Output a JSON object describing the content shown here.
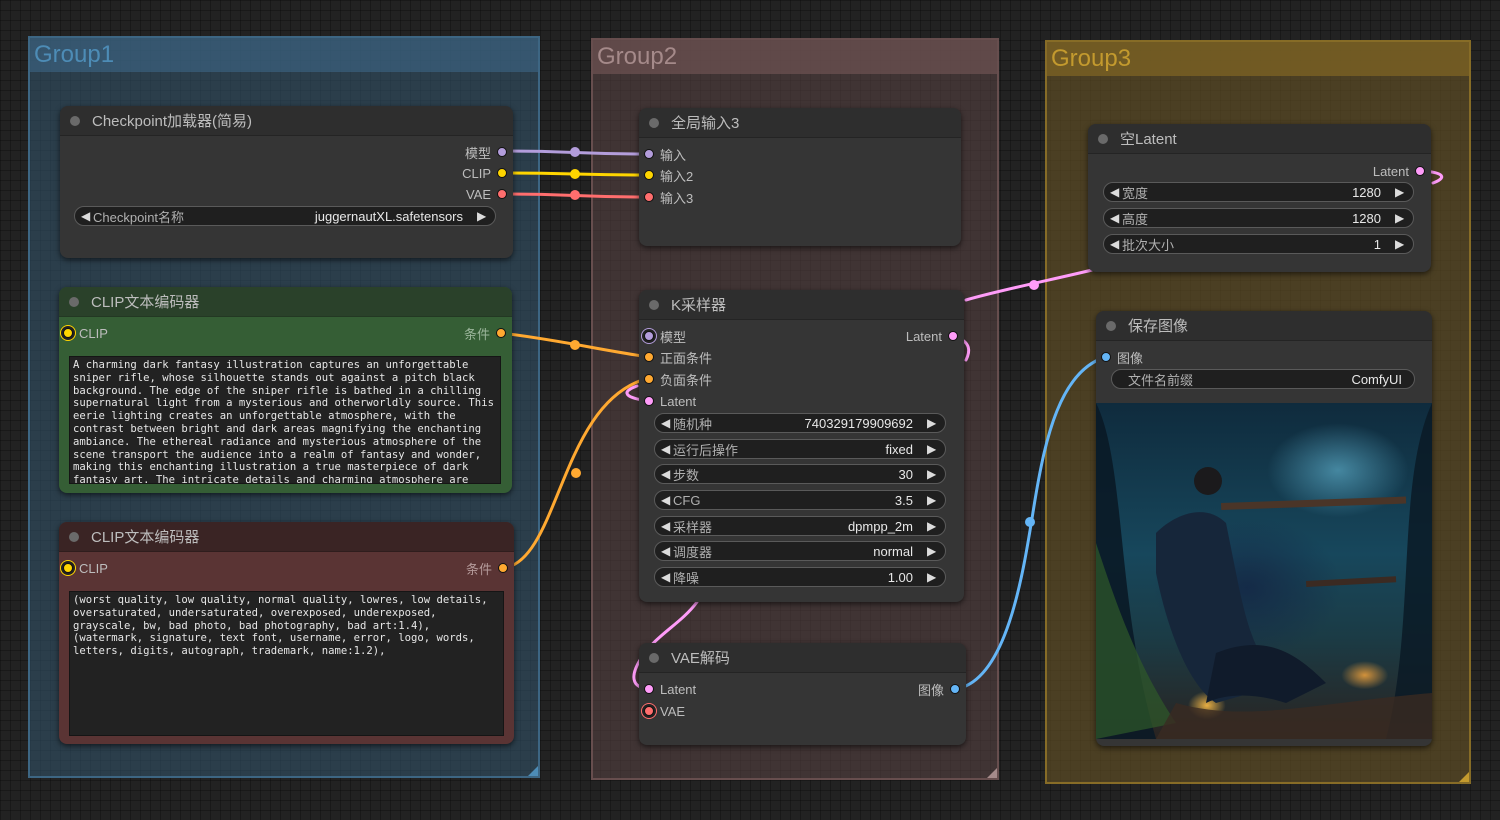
{
  "groups": [
    {
      "title": "Group1",
      "color": "#4d8cb6"
    },
    {
      "title": "Group2",
      "color": "#a58a8a"
    },
    {
      "title": "Group3",
      "color": "#c39a2e"
    }
  ],
  "slot_colors": {
    "model": "#b39ddb",
    "clip": "#ffd500",
    "vae": "#ff6e6e",
    "conditioning": "#ffa931",
    "latent": "#ff9cf9",
    "image": "#64b5f6"
  },
  "nodes": {
    "checkpoint_loader": {
      "title": "Checkpoint加载器(简易)",
      "outputs": [
        "模型",
        "CLIP",
        "VAE"
      ],
      "widget": {
        "label": "Checkpoint名称",
        "value": "juggernautXL.safetensors"
      }
    },
    "clip_positive": {
      "title": "CLIP文本编码器",
      "input": "CLIP",
      "output": "条件",
      "text": "A charming dark fantasy illustration captures an unforgettable sniper rifle, whose silhouette stands out against a pitch black background. The edge of the sniper rifle is bathed in a chilling supernatural light from a mysterious and otherworldly source. This eerie lighting creates an unforgettable atmosphere, with the contrast between bright and dark areas magnifying the enchanting ambiance. The ethereal radiance and mysterious atmosphere of the scene transport the audience into a realm of fantasy and wonder, making this enchanting illustration a true masterpiece of dark fantasy art. The intricate details and charming atmosphere are"
    },
    "clip_negative": {
      "title": "CLIP文本编码器",
      "input": "CLIP",
      "output": "条件",
      "text": "(worst quality, low quality, normal quality, lowres, low details, oversaturated, undersaturated, overexposed, underexposed, grayscale, bw, bad photo, bad photography, bad art:1.4), (watermark, signature, text font, username, error, logo, words, letters, digits, autograph, trademark, name:1.2),"
    },
    "global_input": {
      "title": "全局输入3",
      "inputs": [
        "输入",
        "输入2",
        "输入3"
      ]
    },
    "ksampler": {
      "title": "K采样器",
      "inputs": [
        "模型",
        "正面条件",
        "负面条件",
        "Latent"
      ],
      "output": "Latent",
      "widgets": [
        {
          "label": "随机种",
          "value": "740329179909692"
        },
        {
          "label": "运行后操作",
          "value": "fixed"
        },
        {
          "label": "步数",
          "value": "30"
        },
        {
          "label": "CFG",
          "value": "3.5"
        },
        {
          "label": "采样器",
          "value": "dpmpp_2m"
        },
        {
          "label": "调度器",
          "value": "normal"
        },
        {
          "label": "降噪",
          "value": "1.00"
        }
      ]
    },
    "vae_decode": {
      "title": "VAE解码",
      "inputs": [
        "Latent",
        "VAE"
      ],
      "output": "图像"
    },
    "empty_latent": {
      "title": "空Latent",
      "output": "Latent",
      "widgets": [
        {
          "label": "宽度",
          "value": "1280"
        },
        {
          "label": "高度",
          "value": "1280"
        },
        {
          "label": "批次大小",
          "value": "1"
        }
      ]
    },
    "save_image": {
      "title": "保存图像",
      "input": "图像",
      "widget": {
        "label": "文件名前缀",
        "value": "ComfyUI"
      },
      "preview_alt": "dark fantasy forest sniper illustration"
    }
  },
  "arrows": {
    "left": "◀",
    "right": "▶"
  }
}
